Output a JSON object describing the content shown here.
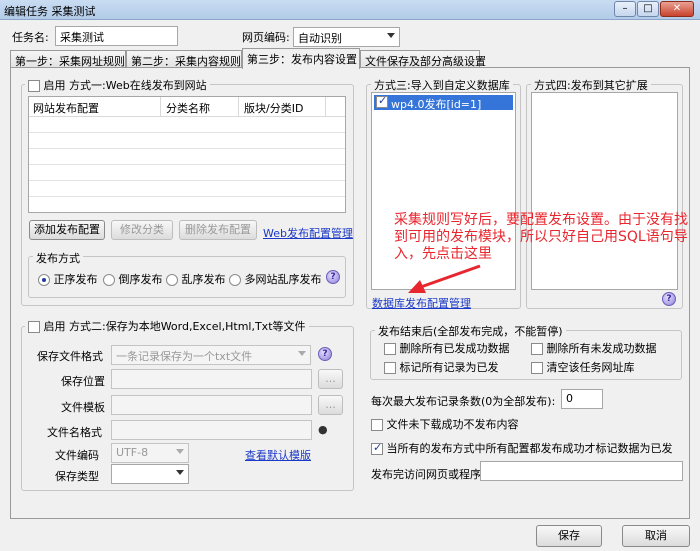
{
  "window": {
    "title": "编辑任务 采集测试",
    "minimize": "–",
    "maximize": "□",
    "close": "✕"
  },
  "task": {
    "name_label": "任务名:",
    "name_value": "采集测试",
    "encoding_label": "网页编码:",
    "encoding_value": "自动识别"
  },
  "tabs": [
    {
      "label": "第一步：采集网址规则"
    },
    {
      "label": "第二步：采集内容规则"
    },
    {
      "label": "第三步：发布内容设置"
    },
    {
      "label": "文件保存及部分高级设置"
    }
  ],
  "method1": {
    "enable_label": "启用",
    "title": "方式一:Web在线发布到网站",
    "columns": [
      "网站发布配置",
      "分类名称",
      "版块/分类ID"
    ],
    "add_btn": "添加发布配置",
    "edit_btn": "修改分类",
    "delete_btn": "删除发布配置",
    "manage_link": "Web发布配置管理",
    "publish_mode_title": "发布方式",
    "modes": [
      "正序发布",
      "倒序发布",
      "乱序发布",
      "多网站乱序发布"
    ],
    "selected_mode": 0
  },
  "method3": {
    "title": "方式三:导入到自定义数据库",
    "item": "wp4.0发布[id=1]",
    "manage_link": "数据库发布配置管理"
  },
  "method4": {
    "title": "方式四:发布到其它扩展"
  },
  "annotation": {
    "text": "采集规则写好后，要配置发布设置。由于没有找到可用的发布模块，所以只好自己用SQL语句导入，先点击这里"
  },
  "method2": {
    "enable_label": "启用",
    "title": "方式二:保存为本地Word,Excel,Html,Txt等文件",
    "format_label": "保存文件格式",
    "format_value": "一条记录保存为一个txt文件",
    "location_label": "保存位置",
    "template_label": "文件模板",
    "filename_label": "文件名格式",
    "encoding_label": "文件编码",
    "encoding_value": "UTF-8",
    "default_template_link": "查看默认模版",
    "save_type_label": "保存类型",
    "browse": "..."
  },
  "after_publish": {
    "title": "发布结束后(全部发布完成，不能暂停)",
    "options": [
      "删除所有已发成功数据",
      "删除所有未发成功数据",
      "标记所有记录为已发",
      "清空该任务网址库"
    ]
  },
  "settings": {
    "max_records_label": "每次最大发布记录条数(0为全部发布):",
    "max_records_value": "0",
    "skip_failed_label": "文件未下载成功不发布内容",
    "mark_published_label": "当所有的发布方式中所有配置都发布成功才标记数据为已发",
    "after_visit_label": "发布完访问网页或程序"
  },
  "footer": {
    "save": "保存",
    "cancel": "取消"
  },
  "colors": {
    "link": "#1b38c6",
    "annotation": "#e8262e",
    "selection": "#3574d8"
  }
}
